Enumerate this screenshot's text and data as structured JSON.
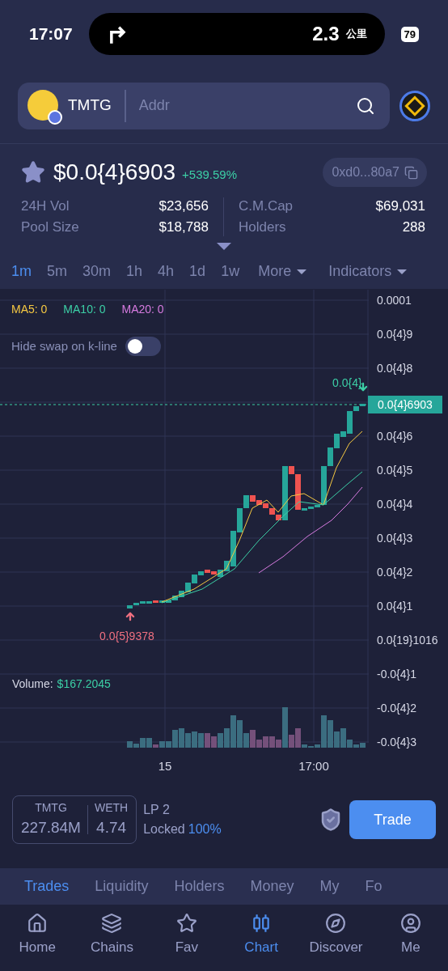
{
  "status_bar": {
    "time": "17:07",
    "distance": "2.3",
    "unit": "公里",
    "battery": "79"
  },
  "search": {
    "token": "TMTG",
    "placeholder": "Addr"
  },
  "price": {
    "starred": false,
    "value": "$0.0{4}6903",
    "change": "+539.59%",
    "address": "0xd0...80a7"
  },
  "stats": [
    {
      "label": "24H Vol",
      "value": "$23,656"
    },
    {
      "label": "Pool Size",
      "value": "$18,788"
    },
    {
      "label": "C.M.Cap",
      "value": "$69,031"
    },
    {
      "label": "Holders",
      "value": "288"
    }
  ],
  "timeframes": [
    {
      "label": "1m",
      "selected": true
    },
    {
      "label": "5m",
      "selected": false
    },
    {
      "label": "30m",
      "selected": false
    },
    {
      "label": "1h",
      "selected": false
    },
    {
      "label": "4h",
      "selected": false
    },
    {
      "label": "1d",
      "selected": false
    },
    {
      "label": "1w",
      "selected": false
    }
  ],
  "menus": [
    "More",
    "Indicators"
  ],
  "chart": {
    "ma": [
      {
        "label": "MA5: 0",
        "color": "#f5c842"
      },
      {
        "label": "MA10: 0",
        "color": "#3ccfa6"
      },
      {
        "label": "MA20: 0",
        "color": "#d77be0"
      }
    ],
    "toggle": {
      "label": "Hide swap on k-line",
      "on": false
    },
    "y_labels": [
      "0.0001",
      "0.0{4}9",
      "0.0{4}8",
      "0.0{4}6",
      "0.0{4}5",
      "0.0{4}4",
      "0.0{4}3",
      "0.0{4}2",
      "0.0{4}1",
      "0.0{19}1016",
      "-0.0{4}1",
      "-0.0{4}2",
      "-0.0{4}3"
    ],
    "current_price": "0.0{4}6903",
    "high_marker": "0.0{4}",
    "low_marker": "0.0{5}9378",
    "volume_label": "Volume:",
    "volume_value": "$167.2045",
    "x_labels": [
      "15",
      "17:00"
    ]
  },
  "pool": {
    "token_a": "TMTG",
    "amount_a": "227.84M",
    "token_b": "WETH",
    "amount_b": "4.74",
    "lp": "LP 2",
    "locked_label": "Locked",
    "locked_value": "100%",
    "trade": "Trade"
  },
  "tabs": [
    {
      "label": "Trades",
      "selected": true
    },
    {
      "label": "Liquidity",
      "selected": false
    },
    {
      "label": "Holders",
      "selected": false
    },
    {
      "label": "Money",
      "selected": false
    },
    {
      "label": "My",
      "selected": false
    },
    {
      "label": "Fo",
      "selected": false
    }
  ],
  "nav": [
    {
      "label": "Home",
      "selected": false
    },
    {
      "label": "Chains",
      "selected": false
    },
    {
      "label": "Fav",
      "selected": false
    },
    {
      "label": "Chart",
      "selected": true
    },
    {
      "label": "Discover",
      "selected": false
    },
    {
      "label": "Me",
      "selected": false
    }
  ]
}
